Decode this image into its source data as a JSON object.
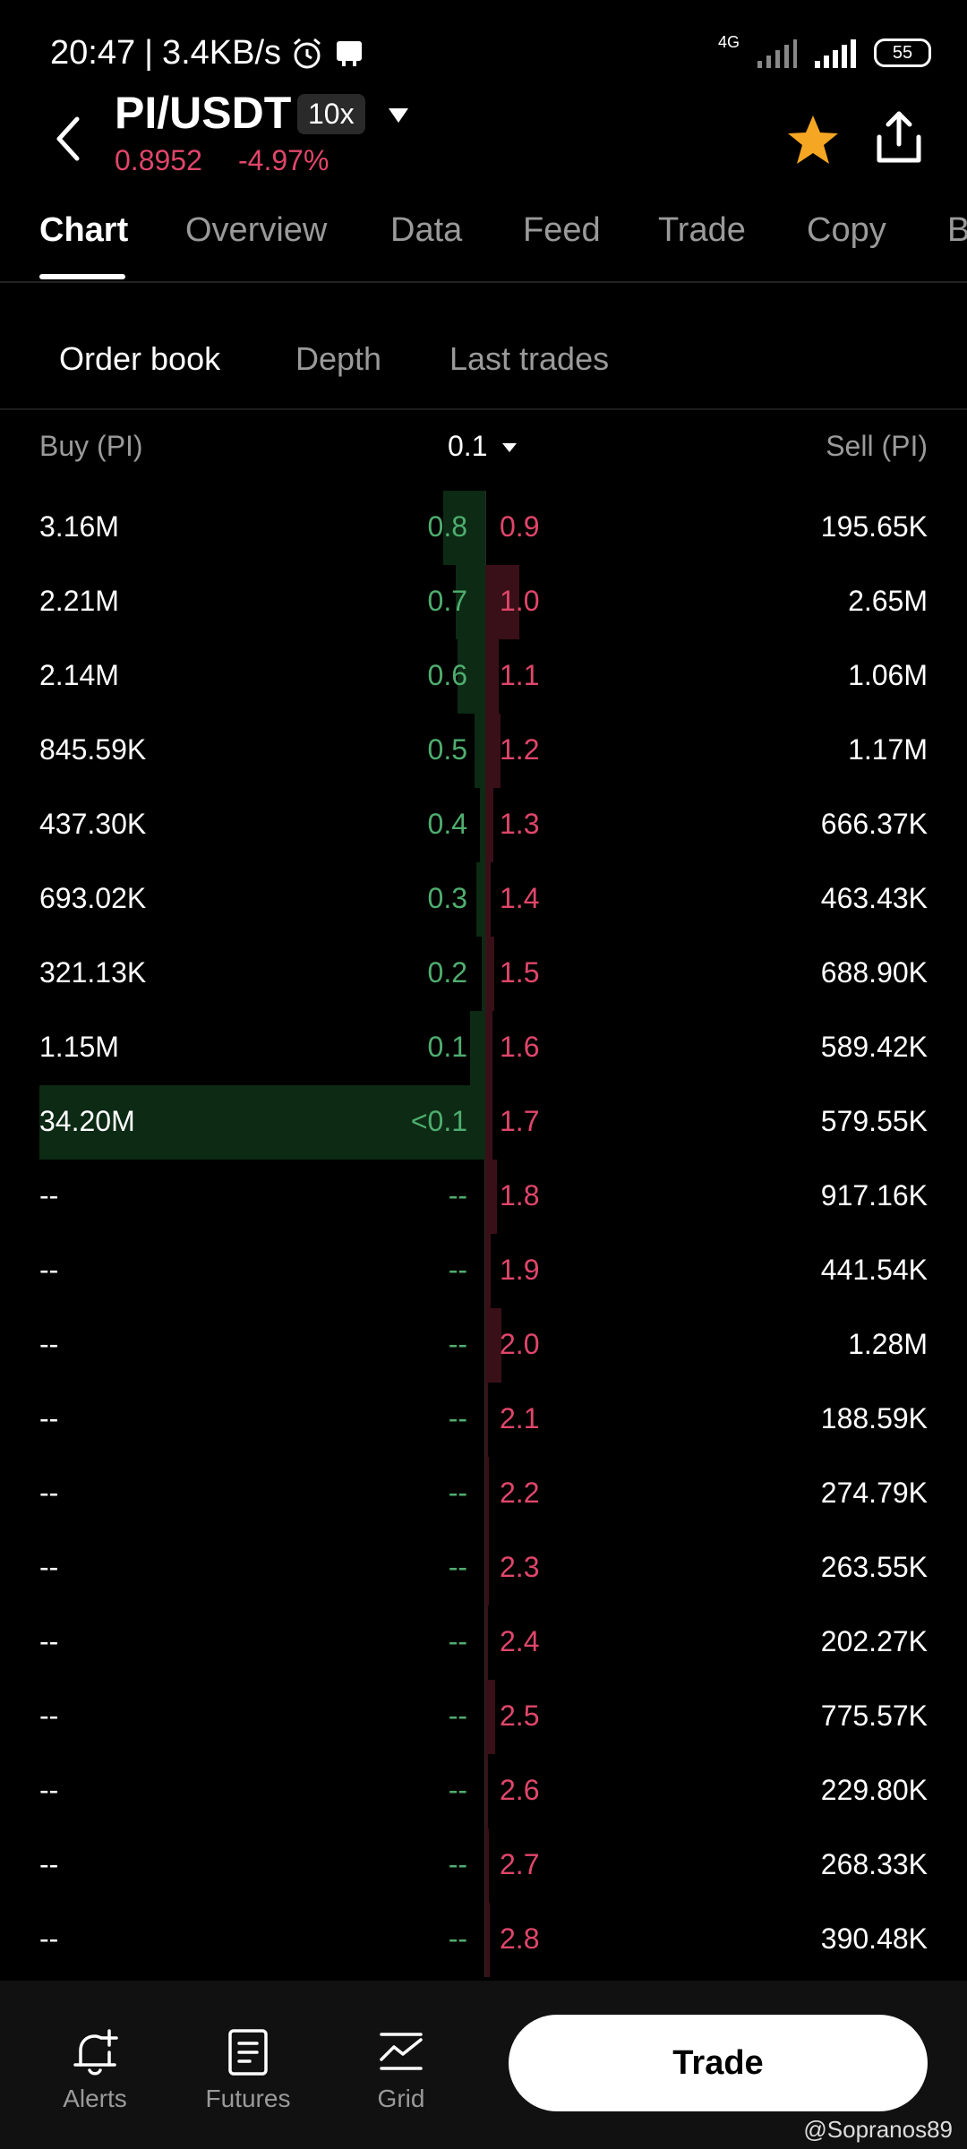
{
  "status_bar": {
    "time": "20:47",
    "speed": "3.4KB/s",
    "network": "4G",
    "battery": "55"
  },
  "header": {
    "pair": "PI/USDT",
    "leverage": "10x",
    "price": "0.8952",
    "change": "-4.97%"
  },
  "main_tabs": [
    "Chart",
    "Overview",
    "Data",
    "Feed",
    "Trade",
    "Copy",
    "B"
  ],
  "sub_tabs": [
    "Order book",
    "Depth",
    "Last trades"
  ],
  "columns": {
    "buy": "Buy (PI)",
    "step": "0.1",
    "sell": "Sell (PI)"
  },
  "order_book": [
    {
      "buy_qty": "3.16M",
      "buy_price": "0.8",
      "sell_price": "0.9",
      "sell_qty": "195.65K",
      "buy_depth": 0.094,
      "sell_depth": 0.0
    },
    {
      "buy_qty": "2.21M",
      "buy_price": "0.7",
      "sell_price": "1.0",
      "sell_qty": "2.65M",
      "buy_depth": 0.066,
      "sell_depth": 0.077
    },
    {
      "buy_qty": "2.14M",
      "buy_price": "0.6",
      "sell_price": "1.1",
      "sell_qty": "1.06M",
      "buy_depth": 0.063,
      "sell_depth": 0.031
    },
    {
      "buy_qty": "845.59K",
      "buy_price": "0.5",
      "sell_price": "1.2",
      "sell_qty": "1.17M",
      "buy_depth": 0.025,
      "sell_depth": 0.034
    },
    {
      "buy_qty": "437.30K",
      "buy_price": "0.4",
      "sell_price": "1.3",
      "sell_qty": "666.37K",
      "buy_depth": 0.013,
      "sell_depth": 0.019
    },
    {
      "buy_qty": "693.02K",
      "buy_price": "0.3",
      "sell_price": "1.4",
      "sell_qty": "463.43K",
      "buy_depth": 0.02,
      "sell_depth": 0.013
    },
    {
      "buy_qty": "321.13K",
      "buy_price": "0.2",
      "sell_price": "1.5",
      "sell_qty": "688.90K",
      "buy_depth": 0.009,
      "sell_depth": 0.02
    },
    {
      "buy_qty": "1.15M",
      "buy_price": "0.1",
      "sell_price": "1.6",
      "sell_qty": "589.42K",
      "buy_depth": 0.034,
      "sell_depth": 0.017
    },
    {
      "buy_qty": "34.20M",
      "buy_price": "<0.1",
      "sell_price": "1.7",
      "sell_qty": "579.55K",
      "buy_depth": 1.0,
      "sell_depth": 0.017
    },
    {
      "buy_qty": "--",
      "buy_price": "--",
      "sell_price": "1.8",
      "sell_qty": "917.16K",
      "buy_depth": 0.0,
      "sell_depth": 0.027
    },
    {
      "buy_qty": "--",
      "buy_price": "--",
      "sell_price": "1.9",
      "sell_qty": "441.54K",
      "buy_depth": 0.0,
      "sell_depth": 0.013
    },
    {
      "buy_qty": "--",
      "buy_price": "--",
      "sell_price": "2.0",
      "sell_qty": "1.28M",
      "buy_depth": 0.0,
      "sell_depth": 0.037
    },
    {
      "buy_qty": "--",
      "buy_price": "--",
      "sell_price": "2.1",
      "sell_qty": "188.59K",
      "buy_depth": 0.0,
      "sell_depth": 0.006
    },
    {
      "buy_qty": "--",
      "buy_price": "--",
      "sell_price": "2.2",
      "sell_qty": "274.79K",
      "buy_depth": 0.0,
      "sell_depth": 0.008
    },
    {
      "buy_qty": "--",
      "buy_price": "--",
      "sell_price": "2.3",
      "sell_qty": "263.55K",
      "buy_depth": 0.0,
      "sell_depth": 0.008
    },
    {
      "buy_qty": "--",
      "buy_price": "--",
      "sell_price": "2.4",
      "sell_qty": "202.27K",
      "buy_depth": 0.0,
      "sell_depth": 0.006
    },
    {
      "buy_qty": "--",
      "buy_price": "--",
      "sell_price": "2.5",
      "sell_qty": "775.57K",
      "buy_depth": 0.0,
      "sell_depth": 0.023
    },
    {
      "buy_qty": "--",
      "buy_price": "--",
      "sell_price": "2.6",
      "sell_qty": "229.80K",
      "buy_depth": 0.0,
      "sell_depth": 0.007
    },
    {
      "buy_qty": "--",
      "buy_price": "--",
      "sell_price": "2.7",
      "sell_qty": "268.33K",
      "buy_depth": 0.0,
      "sell_depth": 0.008
    },
    {
      "buy_qty": "--",
      "buy_price": "--",
      "sell_price": "2.8",
      "sell_qty": "390.48K",
      "buy_depth": 0.0,
      "sell_depth": 0.011
    }
  ],
  "bottom_nav": {
    "alerts": "Alerts",
    "futures": "Futures",
    "grid": "Grid",
    "trade": "Trade"
  },
  "watermark": "@Sopranos89",
  "colors": {
    "buy": "#4fae6f",
    "sell": "#e0466a",
    "star": "#f5a623"
  }
}
